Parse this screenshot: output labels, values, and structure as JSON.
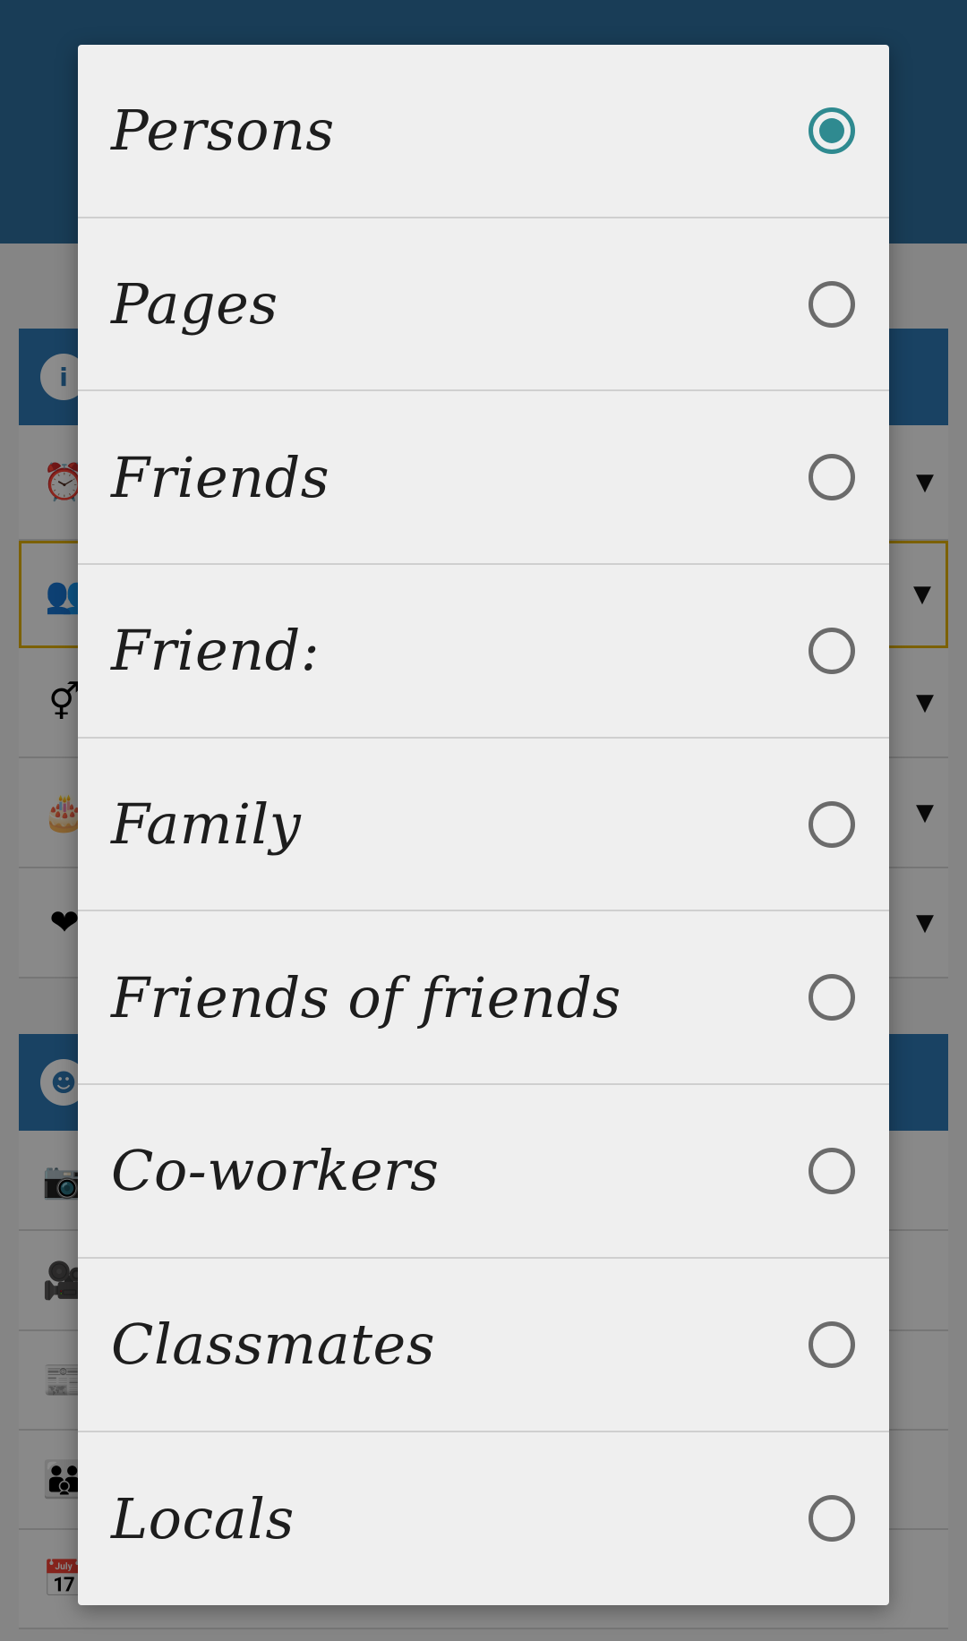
{
  "background": {
    "header_color": "#2f6f9e",
    "section_color": "#2f79b5",
    "section1_icon": "info-icon",
    "rows1": [
      {
        "icon": "clock-icon",
        "glyph": "⏰"
      },
      {
        "icon": "people-icon",
        "glyph": "👥"
      },
      {
        "icon": "gender-icon",
        "glyph": "⚥"
      },
      {
        "icon": "birthday-cake-icon",
        "glyph": "🎂"
      },
      {
        "icon": "heart-icon",
        "glyph": "❤"
      }
    ],
    "section2_icon": "user-avatar-icon",
    "rows2": [
      {
        "icon": "camera-icon",
        "glyph": "📷"
      },
      {
        "icon": "video-camera-icon",
        "glyph": "🎥"
      },
      {
        "icon": "newspaper-icon",
        "glyph": "📰"
      },
      {
        "icon": "group-icon",
        "glyph": "👪"
      },
      {
        "icon": "calendar-icon",
        "glyph": "📅"
      }
    ],
    "caret": "▼"
  },
  "dialog": {
    "accent_color": "#2f8a90",
    "selected_index": 0,
    "options": [
      {
        "label": "Persons"
      },
      {
        "label": "Pages"
      },
      {
        "label": "Friends"
      },
      {
        "label": "Friend:"
      },
      {
        "label": "Family"
      },
      {
        "label": "Friends of friends"
      },
      {
        "label": "Co-workers"
      },
      {
        "label": "Classmates"
      },
      {
        "label": "Locals"
      }
    ]
  }
}
